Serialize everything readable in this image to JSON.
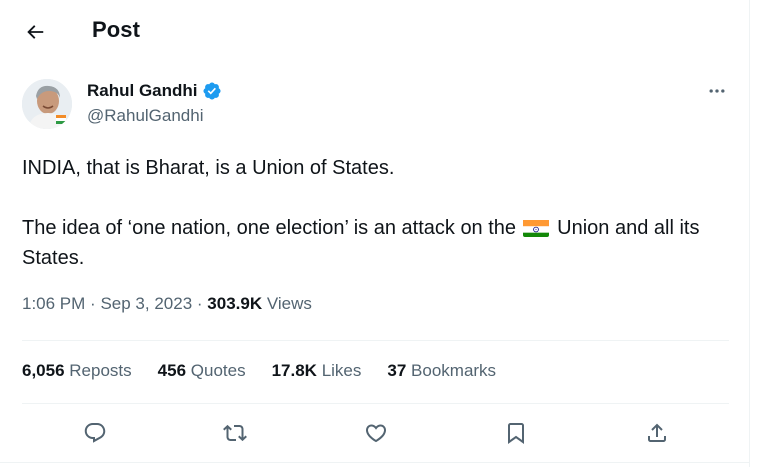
{
  "header": {
    "title": "Post",
    "back_icon": "arrow-left-icon"
  },
  "author": {
    "name": "Rahul Gandhi",
    "handle": "@RahulGandhi",
    "verified": true,
    "verified_color": "#1d9bf0"
  },
  "post": {
    "line1": "INDIA, that is Bharat, is a Union of States.",
    "line2_before": "The idea of ‘one nation, one election’ is an attack on the",
    "line2_emoji": "india-flag-emoji",
    "line2_after": "Union and all its States."
  },
  "meta": {
    "time": "1:06 PM",
    "separator": "·",
    "date": "Sep 3, 2023",
    "views_count": "303.9K",
    "views_label": "Views"
  },
  "stats": {
    "reposts_count": "6,056",
    "reposts_label": "Reposts",
    "quotes_count": "456",
    "quotes_label": "Quotes",
    "likes_count": "17.8K",
    "likes_label": "Likes",
    "bookmarks_count": "37",
    "bookmarks_label": "Bookmarks"
  },
  "actions": [
    "reply-icon",
    "repost-icon",
    "like-icon",
    "bookmark-icon",
    "share-icon"
  ],
  "colors": {
    "text_primary": "#0f1419",
    "text_secondary": "#536471",
    "divider": "#eff3f4",
    "icon": "#536471"
  }
}
